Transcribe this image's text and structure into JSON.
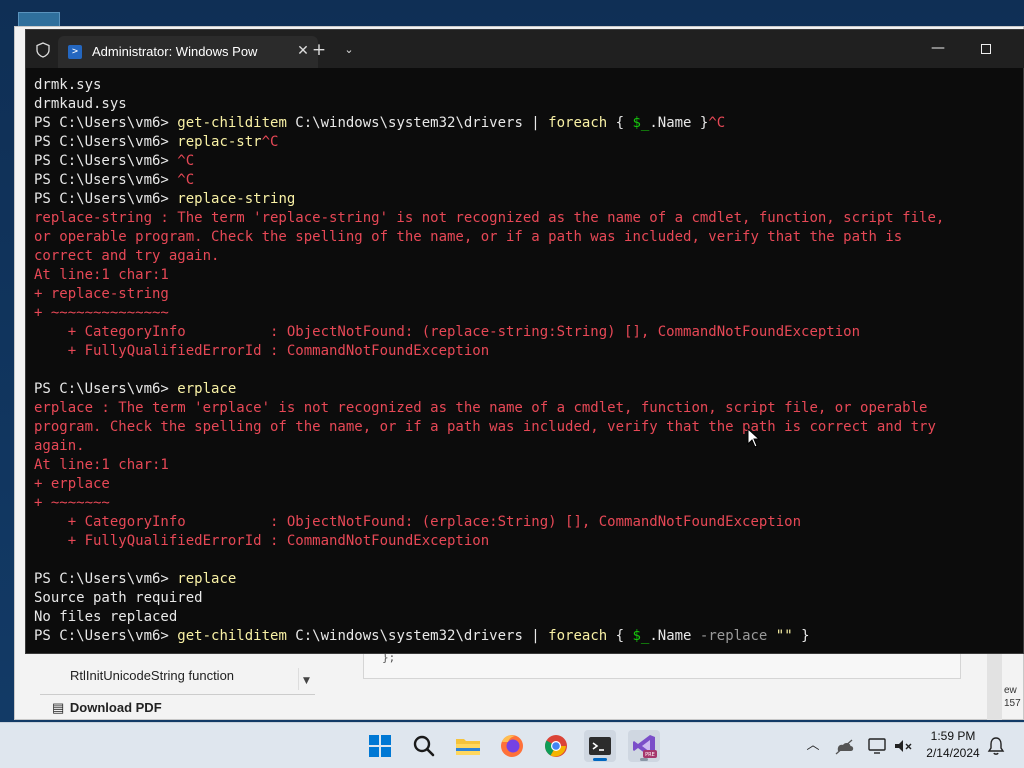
{
  "background": {
    "sidebar_item": "RtlInitUnicodeString function",
    "download_label": "Download PDF",
    "code_snippet": "};",
    "right_text_1": "ew",
    "right_text_2": "157"
  },
  "terminal": {
    "tab_title": "Administrator: Windows PowerShell",
    "lines": [
      [
        {
          "t": "drmk.sys",
          "c": "w"
        }
      ],
      [
        {
          "t": "drmkaud.sys",
          "c": "w"
        }
      ],
      [
        {
          "t": "PS C:\\Users\\vm6> ",
          "c": "w"
        },
        {
          "t": "get-childitem",
          "c": "y"
        },
        {
          "t": " C:\\windows\\system32\\drivers | ",
          "c": "w"
        },
        {
          "t": "foreach",
          "c": "y"
        },
        {
          "t": " { ",
          "c": "w"
        },
        {
          "t": "$_",
          "c": "gr"
        },
        {
          "t": ".Name }",
          "c": "w"
        },
        {
          "t": "^C",
          "c": "r"
        }
      ],
      [
        {
          "t": "PS C:\\Users\\vm6> ",
          "c": "w"
        },
        {
          "t": "replac-str",
          "c": "y"
        },
        {
          "t": "^C",
          "c": "r"
        }
      ],
      [
        {
          "t": "PS C:\\Users\\vm6> ",
          "c": "w"
        },
        {
          "t": "^C",
          "c": "r"
        }
      ],
      [
        {
          "t": "PS C:\\Users\\vm6> ",
          "c": "w"
        },
        {
          "t": "^C",
          "c": "r"
        }
      ],
      [
        {
          "t": "PS C:\\Users\\vm6> ",
          "c": "w"
        },
        {
          "t": "replace-string",
          "c": "y"
        }
      ],
      [
        {
          "t": "replace-string : The term 'replace-string' is not recognized as the name of a cmdlet, function, script file,",
          "c": "r"
        }
      ],
      [
        {
          "t": "or operable program. Check the spelling of the name, or if a path was included, verify that the path is",
          "c": "r"
        }
      ],
      [
        {
          "t": "correct and try again.",
          "c": "r"
        }
      ],
      [
        {
          "t": "At line:1 char:1",
          "c": "r"
        }
      ],
      [
        {
          "t": "+ replace-string",
          "c": "r"
        }
      ],
      [
        {
          "t": "+ ~~~~~~~~~~~~~~",
          "c": "r"
        }
      ],
      [
        {
          "t": "    + CategoryInfo          : ObjectNotFound: (replace-string:String) [], CommandNotFoundException",
          "c": "r"
        }
      ],
      [
        {
          "t": "    + FullyQualifiedErrorId : CommandNotFoundException",
          "c": "r"
        }
      ],
      [
        {
          "t": "",
          "c": "w"
        }
      ],
      [
        {
          "t": "PS C:\\Users\\vm6> ",
          "c": "w"
        },
        {
          "t": "erplace",
          "c": "y"
        }
      ],
      [
        {
          "t": "erplace : The term 'erplace' is not recognized as the name of a cmdlet, function, script file, or operable",
          "c": "r"
        }
      ],
      [
        {
          "t": "program. Check the spelling of the name, or if a path was included, verify that the path is correct and try",
          "c": "r"
        }
      ],
      [
        {
          "t": "again.",
          "c": "r"
        }
      ],
      [
        {
          "t": "At line:1 char:1",
          "c": "r"
        }
      ],
      [
        {
          "t": "+ erplace",
          "c": "r"
        }
      ],
      [
        {
          "t": "+ ~~~~~~~",
          "c": "r"
        }
      ],
      [
        {
          "t": "    + CategoryInfo          : ObjectNotFound: (erplace:String) [], CommandNotFoundException",
          "c": "r"
        }
      ],
      [
        {
          "t": "    + FullyQualifiedErrorId : CommandNotFoundException",
          "c": "r"
        }
      ],
      [
        {
          "t": "",
          "c": "w"
        }
      ],
      [
        {
          "t": "PS C:\\Users\\vm6> ",
          "c": "w"
        },
        {
          "t": "replace",
          "c": "y"
        }
      ],
      [
        {
          "t": "Source path required",
          "c": "w"
        }
      ],
      [
        {
          "t": "No files replaced",
          "c": "w"
        }
      ],
      [
        {
          "t": "PS C:\\Users\\vm6> ",
          "c": "w"
        },
        {
          "t": "get-childitem",
          "c": "y"
        },
        {
          "t": " C:\\windows\\system32\\drivers | ",
          "c": "w"
        },
        {
          "t": "foreach",
          "c": "y"
        },
        {
          "t": " { ",
          "c": "w"
        },
        {
          "t": "$_",
          "c": "gr"
        },
        {
          "t": ".Name ",
          "c": "w"
        },
        {
          "t": "-replace",
          "c": "g"
        },
        {
          "t": " ",
          "c": "w"
        },
        {
          "t": "\"\"",
          "c": "y"
        },
        {
          "t": " }",
          "c": "w"
        }
      ]
    ]
  },
  "taskbar": {
    "time": "1:59 PM",
    "date": "2/14/2024",
    "apps": [
      "start",
      "search",
      "file-explorer",
      "firefox",
      "chrome",
      "terminal",
      "visual-studio"
    ]
  },
  "colors": {
    "console_bg": "#0c0c0c",
    "error_red": "#e74856",
    "command_yellow": "#f9f1a5",
    "variable_green": "#16c60c"
  }
}
